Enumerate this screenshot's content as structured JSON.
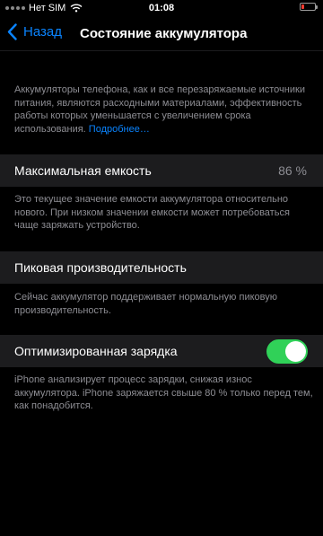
{
  "status_bar": {
    "carrier": "Нет SIM",
    "time": "01:08",
    "battery_color": "#ff3b30"
  },
  "nav": {
    "back_label": "Назад",
    "title": "Состояние аккумулятора"
  },
  "intro": {
    "text": "Аккумуляторы телефона, как и все перезаряжаемые источники питания, являются расходными материалами, эффективность работы которых уменьшается с увеличением срока использования. ",
    "link": "Подробнее…"
  },
  "max_capacity": {
    "label": "Максимальная емкость",
    "value": "86 %",
    "footer": "Это текущее значение емкости аккумулятора относительно нового. При низком значении емкости может потребоваться чаще заряжать устройство."
  },
  "peak_performance": {
    "label": "Пиковая производительность",
    "footer": "Сейчас аккумулятор поддерживает нормальную пиковую производительность."
  },
  "optimized_charging": {
    "label": "Оптимизированная зарядка",
    "enabled": true,
    "footer": "iPhone анализирует процесс зарядки, снижая износ аккумулятора. iPhone заряжается свыше 80 % только перед тем, как понадобится."
  },
  "colors": {
    "accent": "#0a84ff",
    "toggle_on": "#30d158",
    "cell_bg": "#1c1c1e",
    "secondary_text": "#8d8d93"
  }
}
